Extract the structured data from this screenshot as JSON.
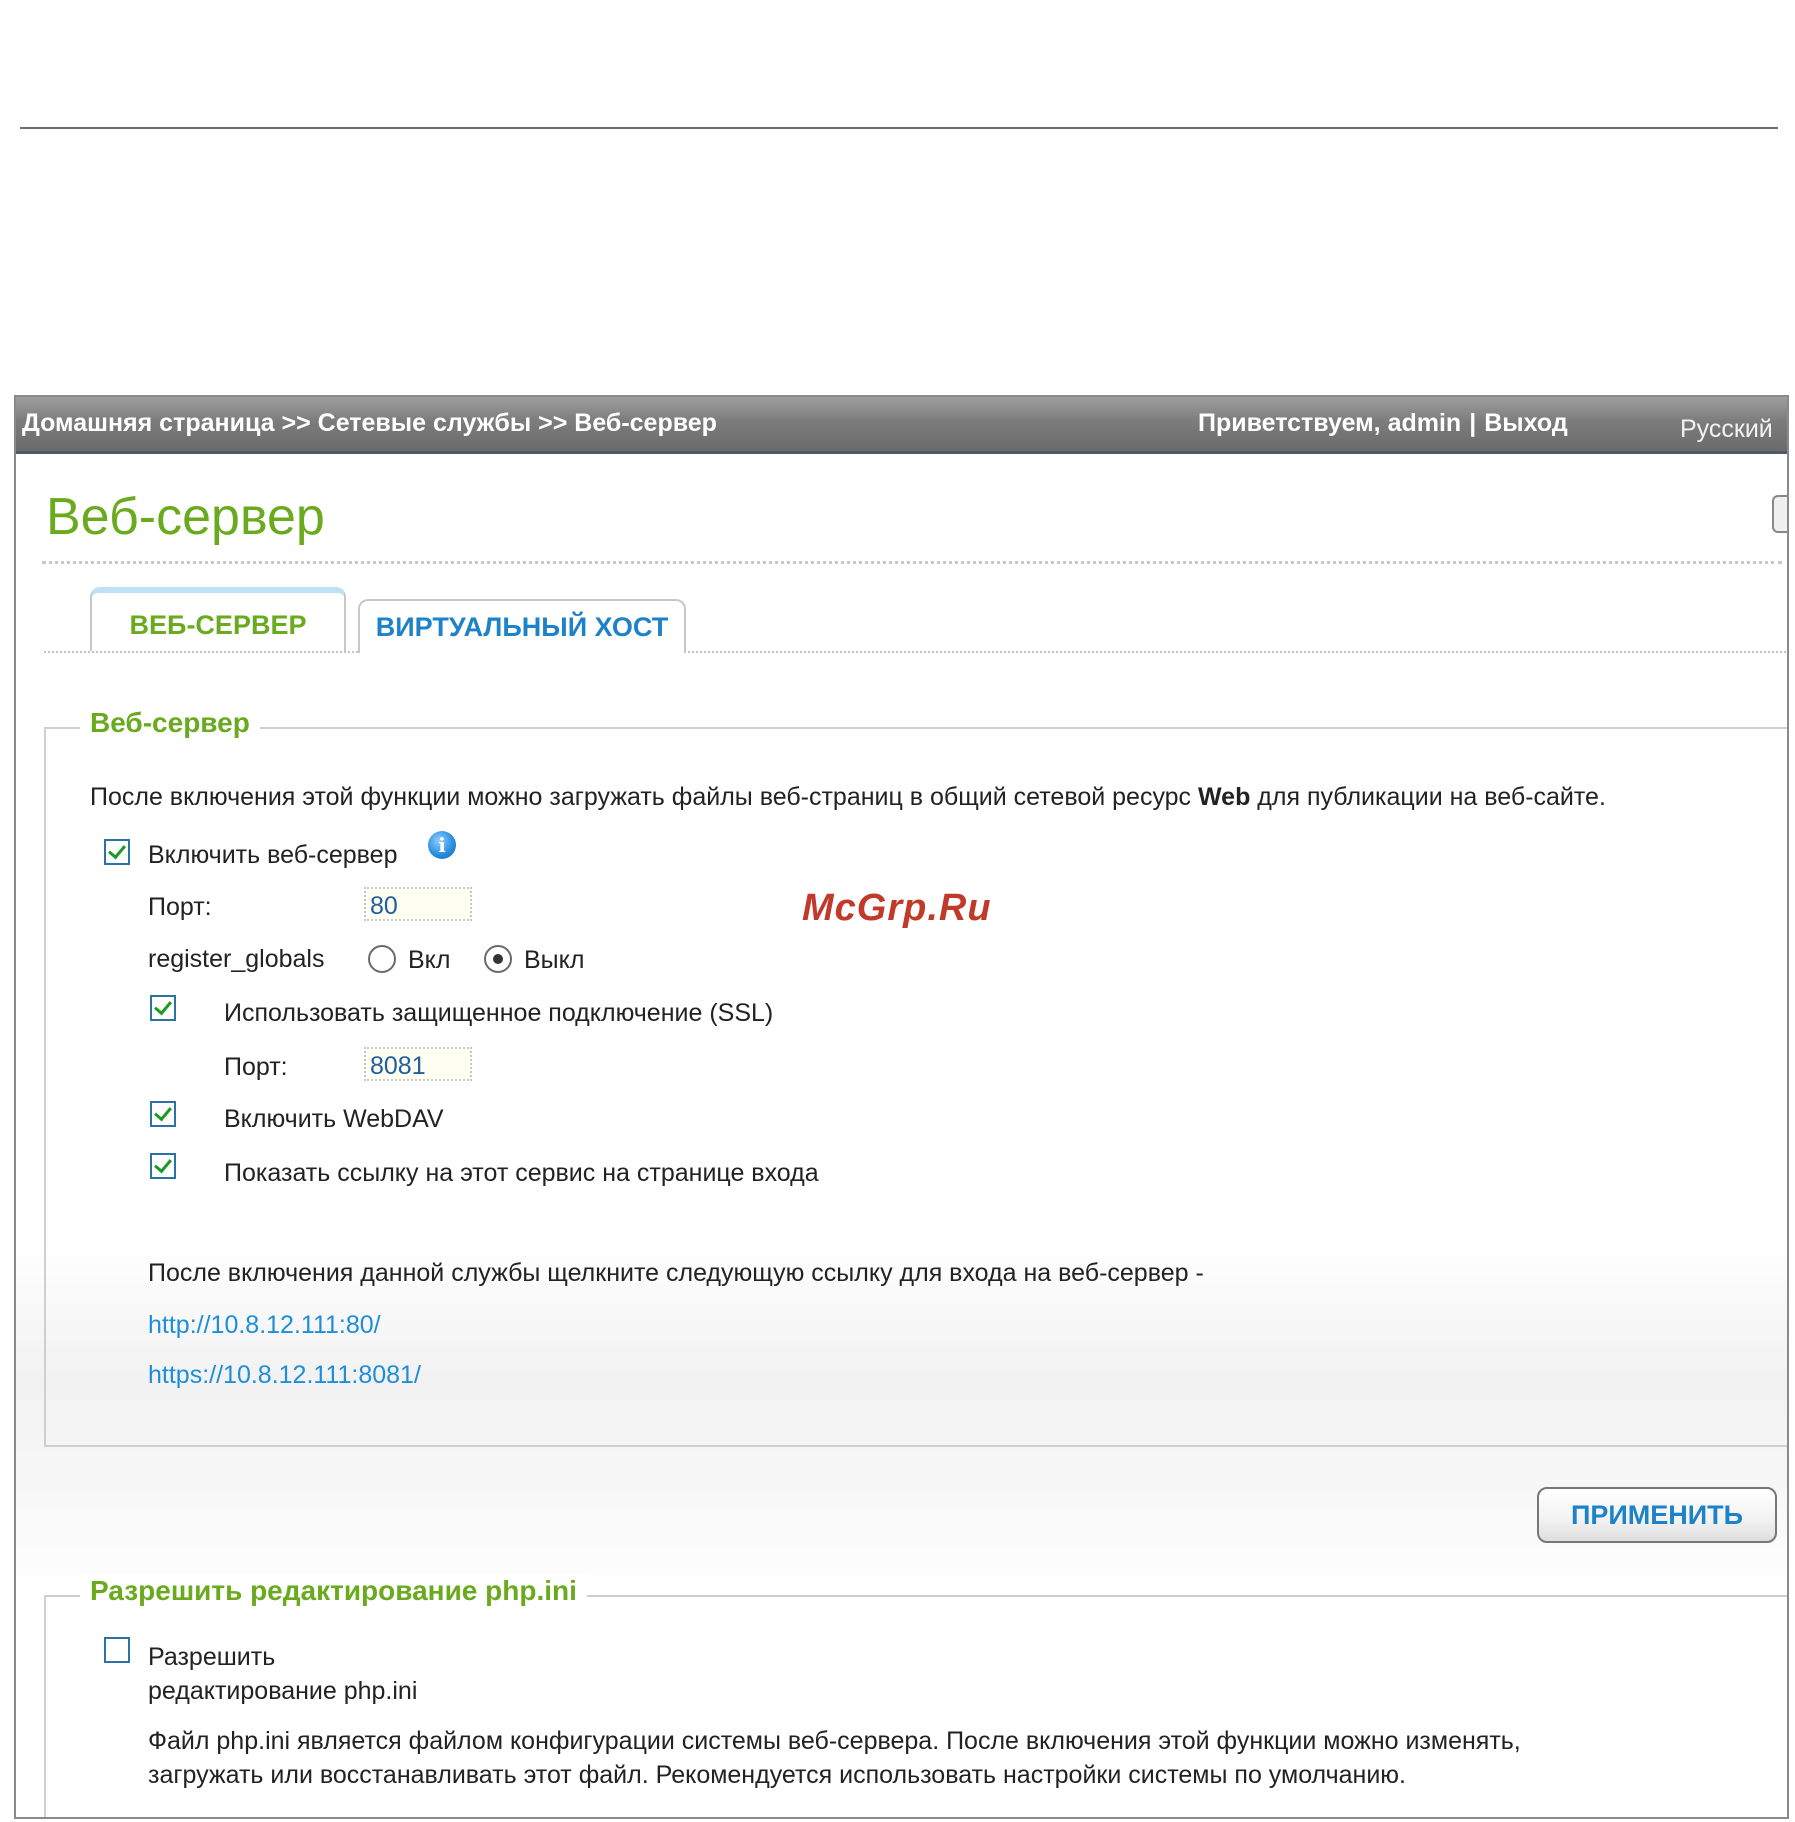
{
  "header": {
    "breadcrumb": "Домашняя страница >> Сетевые службы >> Веб-сервер",
    "greeting": "Приветствуем, admin",
    "separator": "|",
    "logout": "Выход",
    "language": "Русский"
  },
  "page_title": "Веб-сервер",
  "tabs": [
    {
      "label": "ВЕБ-СЕРВЕР",
      "active": true
    },
    {
      "label": "ВИРТУАЛЬНЫЙ ХОСТ",
      "active": false
    }
  ],
  "webserver_section": {
    "legend": "Веб-сервер",
    "description_pre": "После включения этой функции можно загружать файлы веб-страниц в общий сетевой ресурс ",
    "description_bold": "Web",
    "description_post": " для публикации на веб-сайте.",
    "enable_label": "Включить веб-сервер",
    "enable_checked": true,
    "info_icon": "i",
    "port_label": "Порт:",
    "port_value": "80",
    "register_globals_label": "register_globals",
    "radio_on_label": "Вкл",
    "radio_off_label": "Выкл",
    "register_globals_selected": "Выкл",
    "ssl_label": "Использовать защищенное подключение (SSL)",
    "ssl_checked": true,
    "ssl_port_label": "Порт:",
    "ssl_port_value": "8081",
    "webdav_label": "Включить WebDAV",
    "webdav_checked": true,
    "show_link_label": "Показать ссылку на этот сервис на странице входа",
    "show_link_checked": true,
    "access_note": "После включения данной службы щелкните следующую ссылку для входа на веб-сервер -",
    "http_link": "http://10.8.12.111:80/",
    "https_link": "https://10.8.12.111:8081/"
  },
  "apply_button": "ПРИМЕНИТЬ",
  "phpini_section": {
    "legend": "Разрешить редактирование php.ini",
    "allow_label_line1": "Разрешить",
    "allow_label_line2": "редактирование php.ini",
    "allow_checked": false,
    "note_line1": "Файл php.ini является файлом конфигурации системы веб-сервера. После включения этой функции можно изменять,",
    "note_line2": "загружать или восстанавливать этот файл. Рекомендуется использовать настройки системы по умолчанию."
  },
  "watermark": "McGrp.Ru",
  "colors": {
    "accent_green": "#6aaa1e",
    "link_blue": "#1e8ed8",
    "header_gray": "#7c7c7c"
  }
}
